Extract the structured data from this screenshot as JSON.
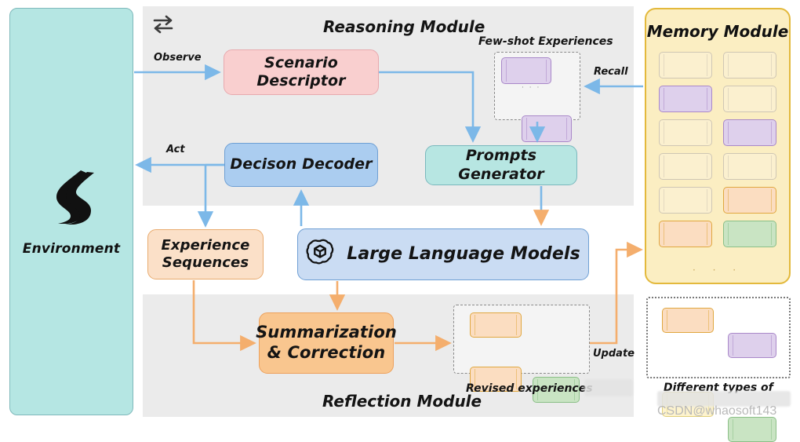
{
  "environment": {
    "label": "Environment",
    "icon": "winding-road-icon",
    "color": "#b5e6e3"
  },
  "reasoning_module": {
    "title": "Reasoning Module",
    "loop_icon": "refresh-loop-icon",
    "nodes": {
      "scenario_descriptor": "Scenario Descriptor",
      "decision_decoder": "Decison Decoder",
      "prompts_generator": "Prompts Generator"
    },
    "few_shot": {
      "caption": "Few-shot Experiences",
      "cards": [
        "purple",
        "purple"
      ],
      "dots": "· · ·"
    }
  },
  "middle_row": {
    "experience_sequences": "Experience\nSequences",
    "experience_sequences_line1": "Experience",
    "experience_sequences_line2": "Sequences",
    "llm": "Large Language Models",
    "llm_icon": "openai-logo-icon"
  },
  "reflection_module": {
    "title": "Reflection Module",
    "summarization": "Summarization\n& Correction",
    "summarization_line1": "Summarization",
    "summarization_line2": "& Correction",
    "revised": {
      "caption": "Revised experiences",
      "cards": [
        "orange",
        "orange",
        "green"
      ]
    }
  },
  "memory_module": {
    "title": "Memory Module",
    "dots": "· · ·",
    "cells": [
      [
        "empty",
        "empty"
      ],
      [
        "purple",
        "empty"
      ],
      [
        "empty",
        "purple"
      ],
      [
        "empty",
        "empty"
      ],
      [
        "empty",
        "orange"
      ],
      [
        "orange",
        "green"
      ]
    ]
  },
  "legend": {
    "caption": "Different types of",
    "cards": [
      [
        "orange",
        "purple"
      ],
      [
        "yellow",
        "green"
      ]
    ]
  },
  "edges": {
    "observe": "Observe",
    "act": "Act",
    "recall": "Recall",
    "update": "Update"
  },
  "watermark": "CSDN@whaosoft143",
  "colors": {
    "band": "#ebebeb",
    "blue_arrow": "#7cb8e8",
    "orange_arrow": "#f4ae6d",
    "memory_border": "#e3b93c"
  }
}
